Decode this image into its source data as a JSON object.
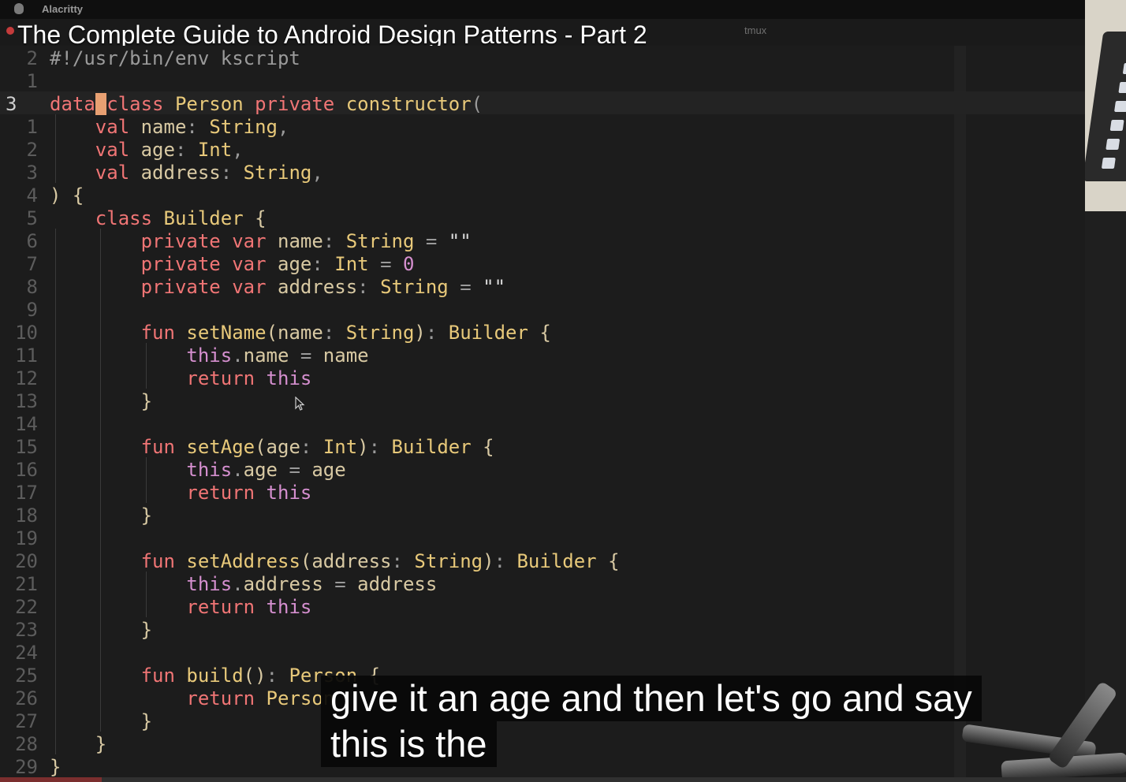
{
  "menubar": {
    "app_name": "Alacritty"
  },
  "video": {
    "title": "The Complete Guide to Android Design Patterns - Part 2",
    "progress": 0.09
  },
  "terminal": {
    "multiplexer_label": "tmux"
  },
  "editor": {
    "lines": [
      {
        "n": "2",
        "tokens": [
          [
            "#!/usr/bin/env kscript",
            "sh"
          ]
        ]
      },
      {
        "n": "1",
        "tokens": []
      },
      {
        "n": "3",
        "current": true,
        "tokens": [
          [
            "data",
            "kw"
          ],
          [
            " ",
            "cur-block"
          ],
          [
            "class",
            "kw"
          ],
          [
            " "
          ],
          [
            "Person",
            "ty"
          ],
          [
            " "
          ],
          [
            "private",
            "kw"
          ],
          [
            " "
          ],
          [
            "constructor",
            "fn"
          ],
          [
            "(",
            "pu"
          ]
        ]
      },
      {
        "n": "1",
        "tokens": [
          [
            "    "
          ],
          [
            "val",
            "kw"
          ],
          [
            " name"
          ],
          [
            ":",
            "pu"
          ],
          [
            " "
          ],
          [
            "String",
            "ty"
          ],
          [
            ",",
            "pu"
          ]
        ]
      },
      {
        "n": "2",
        "tokens": [
          [
            "    "
          ],
          [
            "val",
            "kw"
          ],
          [
            " age"
          ],
          [
            ":",
            "pu"
          ],
          [
            " "
          ],
          [
            "Int",
            "ty"
          ],
          [
            ",",
            "pu"
          ]
        ]
      },
      {
        "n": "3",
        "tokens": [
          [
            "    "
          ],
          [
            "val",
            "kw"
          ],
          [
            " address"
          ],
          [
            ":",
            "pu"
          ],
          [
            " "
          ],
          [
            "String",
            "ty"
          ],
          [
            ",",
            "pu"
          ]
        ]
      },
      {
        "n": "4",
        "tokens": [
          [
            ") {"
          ]
        ]
      },
      {
        "n": "5",
        "tokens": [
          [
            "    "
          ],
          [
            "class",
            "kw"
          ],
          [
            " "
          ],
          [
            "Builder",
            "ty"
          ],
          [
            " {"
          ]
        ]
      },
      {
        "n": "6",
        "tokens": [
          [
            "        "
          ],
          [
            "private",
            "kw"
          ],
          [
            " "
          ],
          [
            "var",
            "kw"
          ],
          [
            " name"
          ],
          [
            ":",
            "pu"
          ],
          [
            " "
          ],
          [
            "String",
            "ty"
          ],
          [
            " = ",
            "pu"
          ],
          [
            "\"\"",
            "str"
          ]
        ]
      },
      {
        "n": "7",
        "tokens": [
          [
            "        "
          ],
          [
            "private",
            "kw"
          ],
          [
            " "
          ],
          [
            "var",
            "kw"
          ],
          [
            " age"
          ],
          [
            ":",
            "pu"
          ],
          [
            " "
          ],
          [
            "Int",
            "ty"
          ],
          [
            " = ",
            "pu"
          ],
          [
            "0",
            "num"
          ]
        ]
      },
      {
        "n": "8",
        "tokens": [
          [
            "        "
          ],
          [
            "private",
            "kw"
          ],
          [
            " "
          ],
          [
            "var",
            "kw"
          ],
          [
            " address"
          ],
          [
            ":",
            "pu"
          ],
          [
            " "
          ],
          [
            "String",
            "ty"
          ],
          [
            " = ",
            "pu"
          ],
          [
            "\"\"",
            "str"
          ]
        ]
      },
      {
        "n": "9",
        "tokens": []
      },
      {
        "n": "10",
        "tokens": [
          [
            "        "
          ],
          [
            "fun",
            "kw"
          ],
          [
            " "
          ],
          [
            "setName",
            "fn"
          ],
          [
            "(name"
          ],
          [
            ":",
            "pu"
          ],
          [
            " "
          ],
          [
            "String",
            "ty"
          ],
          [
            ")"
          ],
          [
            ":",
            "pu"
          ],
          [
            " "
          ],
          [
            "Builder",
            "ty"
          ],
          [
            " {"
          ]
        ]
      },
      {
        "n": "11",
        "tokens": [
          [
            "            "
          ],
          [
            "this",
            "th"
          ],
          [
            ".",
            "pu"
          ],
          [
            "name"
          ],
          [
            " = ",
            "pu"
          ],
          [
            "name"
          ]
        ]
      },
      {
        "n": "12",
        "tokens": [
          [
            "            "
          ],
          [
            "return",
            "kw"
          ],
          [
            " "
          ],
          [
            "this",
            "th"
          ]
        ]
      },
      {
        "n": "13",
        "tokens": [
          [
            "        }"
          ]
        ]
      },
      {
        "n": "14",
        "tokens": []
      },
      {
        "n": "15",
        "tokens": [
          [
            "        "
          ],
          [
            "fun",
            "kw"
          ],
          [
            " "
          ],
          [
            "setAge",
            "fn"
          ],
          [
            "(age"
          ],
          [
            ":",
            "pu"
          ],
          [
            " "
          ],
          [
            "Int",
            "ty"
          ],
          [
            ")"
          ],
          [
            ":",
            "pu"
          ],
          [
            " "
          ],
          [
            "Builder",
            "ty"
          ],
          [
            " {"
          ]
        ]
      },
      {
        "n": "16",
        "tokens": [
          [
            "            "
          ],
          [
            "this",
            "th"
          ],
          [
            ".",
            "pu"
          ],
          [
            "age"
          ],
          [
            " = ",
            "pu"
          ],
          [
            "age"
          ]
        ]
      },
      {
        "n": "17",
        "tokens": [
          [
            "            "
          ],
          [
            "return",
            "kw"
          ],
          [
            " "
          ],
          [
            "this",
            "th"
          ]
        ]
      },
      {
        "n": "18",
        "tokens": [
          [
            "        }"
          ]
        ]
      },
      {
        "n": "19",
        "tokens": []
      },
      {
        "n": "20",
        "tokens": [
          [
            "        "
          ],
          [
            "fun",
            "kw"
          ],
          [
            " "
          ],
          [
            "setAddress",
            "fn"
          ],
          [
            "(address"
          ],
          [
            ":",
            "pu"
          ],
          [
            " "
          ],
          [
            "String",
            "ty"
          ],
          [
            ")"
          ],
          [
            ":",
            "pu"
          ],
          [
            " "
          ],
          [
            "Builder",
            "ty"
          ],
          [
            " {"
          ]
        ]
      },
      {
        "n": "21",
        "tokens": [
          [
            "            "
          ],
          [
            "this",
            "th"
          ],
          [
            ".",
            "pu"
          ],
          [
            "address"
          ],
          [
            " = ",
            "pu"
          ],
          [
            "address"
          ]
        ]
      },
      {
        "n": "22",
        "tokens": [
          [
            "            "
          ],
          [
            "return",
            "kw"
          ],
          [
            " "
          ],
          [
            "this",
            "th"
          ]
        ]
      },
      {
        "n": "23",
        "tokens": [
          [
            "        }"
          ]
        ]
      },
      {
        "n": "24",
        "tokens": []
      },
      {
        "n": "25",
        "tokens": [
          [
            "        "
          ],
          [
            "fun",
            "kw"
          ],
          [
            " "
          ],
          [
            "build",
            "fn"
          ],
          [
            "()"
          ],
          [
            ":",
            "pu"
          ],
          [
            " "
          ],
          [
            "Person",
            "ty"
          ],
          [
            " {"
          ]
        ]
      },
      {
        "n": "26",
        "tokens": [
          [
            "            "
          ],
          [
            "return",
            "kw"
          ],
          [
            " "
          ],
          [
            "Person",
            "ty"
          ]
        ]
      },
      {
        "n": "27",
        "tokens": [
          [
            "        }"
          ]
        ]
      },
      {
        "n": "28",
        "tokens": [
          [
            "    }"
          ]
        ]
      },
      {
        "n": "29",
        "tokens": [
          [
            "}"
          ]
        ]
      }
    ]
  },
  "captions": {
    "line1": "give it an age and then let's go and say",
    "line2": "this is the"
  }
}
